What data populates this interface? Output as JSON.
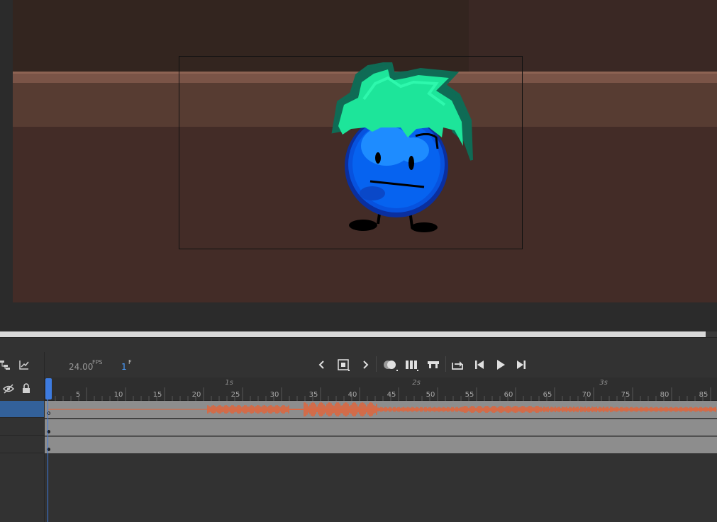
{
  "colors": {
    "stage_floor": "#432c27",
    "stage_shelf": "#573c32",
    "ledge": "#7a5447",
    "waveform": "#e2643a",
    "playhead": "#3d7be0",
    "selected_layer": "#33619a",
    "character_body": "#0a55d9",
    "character_hair": "#1de59a"
  },
  "timeline": {
    "fps_value": "24.00",
    "fps_unit": "FPS",
    "current_frame": "1",
    "frame_unit": "F",
    "toolbar_left_icons": [
      "layer-parenting-icon",
      "graph-editor-icon"
    ],
    "toolbar_icons": [
      "previous-keyframe-icon",
      "insert-keyframe-icon",
      "next-keyframe-icon",
      "onion-skin-icon",
      "edit-multiple-frames-icon",
      "center-frame-icon",
      "loop-icon",
      "step-back-icon",
      "play-icon",
      "step-forward-icon"
    ],
    "ruler": {
      "frame_labels": [
        "5",
        "10",
        "15",
        "20",
        "25",
        "30",
        "35",
        "40",
        "45",
        "50",
        "55",
        "60",
        "65",
        "70",
        "75",
        "80",
        "85"
      ],
      "seconds_labels": [
        "1s",
        "2s",
        "3s"
      ]
    },
    "layer_header_icons": [
      "hide-all-layers-icon",
      "lock-all-layers-icon"
    ],
    "layers": [
      {
        "selected": true,
        "has_audio": true
      },
      {
        "selected": false,
        "has_audio": false
      },
      {
        "selected": false,
        "has_audio": false
      }
    ]
  }
}
